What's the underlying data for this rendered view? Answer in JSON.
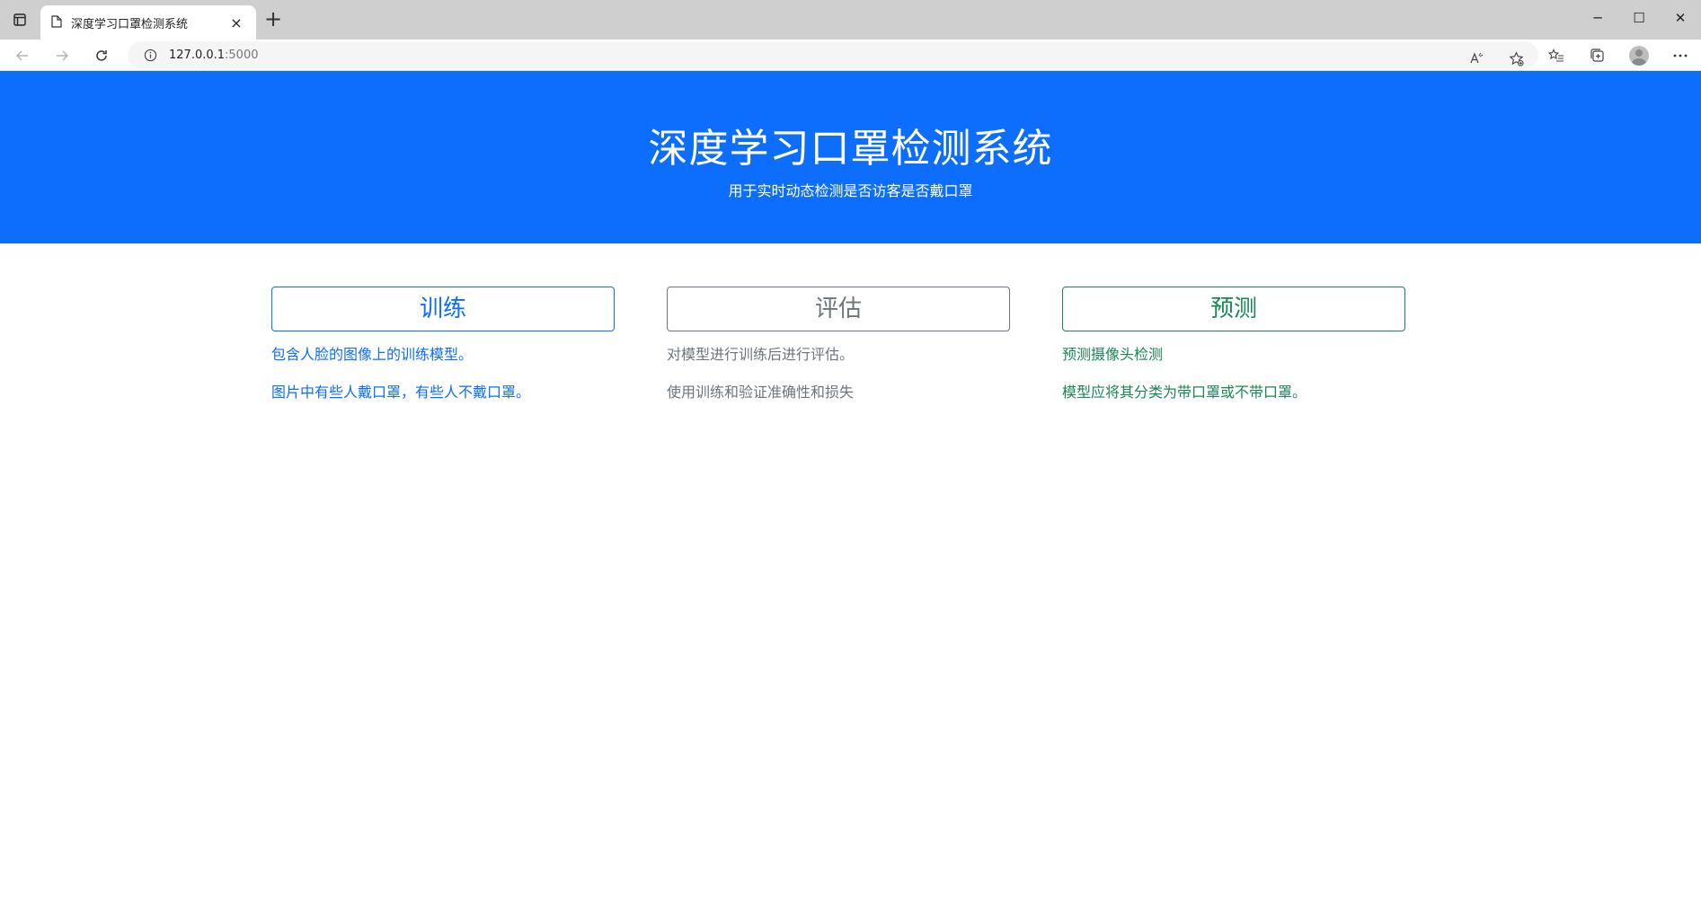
{
  "browser": {
    "tab_title": "深度学习口罩检测系统",
    "tab_close": "×",
    "new_tab": "+",
    "url_host": "127.0.0.1",
    "url_port": ":5000",
    "window_controls": {
      "minimize": "─",
      "maximize": "☐",
      "close": "✕"
    }
  },
  "hero": {
    "title": "深度学习口罩检测系统",
    "subtitle": "用于实时动态检测是否访客是否戴口罩",
    "background": "#0d6efd"
  },
  "cards": [
    {
      "button": "训练",
      "line1": "包含人脸的图像上的训练模型。",
      "line2": "图片中有些人戴口罩，有些人不戴口罩。",
      "color": "#0d6efd"
    },
    {
      "button": "评估",
      "line1": "对模型进行训练后进行评估。",
      "line2": "使用训练和验证准确性和损失",
      "color": "#6c757d"
    },
    {
      "button": "预测",
      "line1": "预测摄像头检测",
      "line2": "模型应将其分类为带口罩或不带口罩。",
      "color": "#198754"
    }
  ]
}
